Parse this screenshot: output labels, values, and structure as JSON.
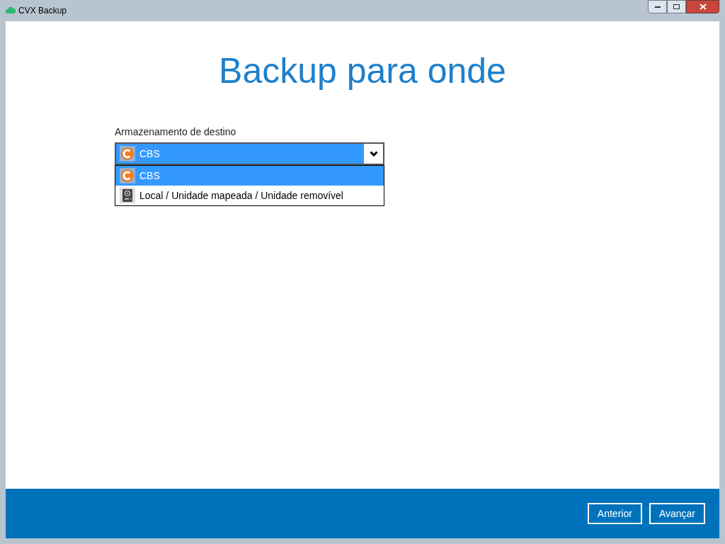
{
  "window": {
    "title": "CVX Backup"
  },
  "heading": "Backup para onde",
  "destination": {
    "label": "Armazenamento de destino",
    "value": {
      "label": "CBS",
      "kind": "cloud"
    },
    "expanded": true,
    "options": [
      {
        "label": "CBS",
        "kind": "cloud",
        "selected": true
      },
      {
        "label": "Local / Unidade mapeada / Unidade removível",
        "kind": "drive",
        "selected": false
      }
    ]
  },
  "buttons": [
    "Anterior",
    "Avançar"
  ]
}
